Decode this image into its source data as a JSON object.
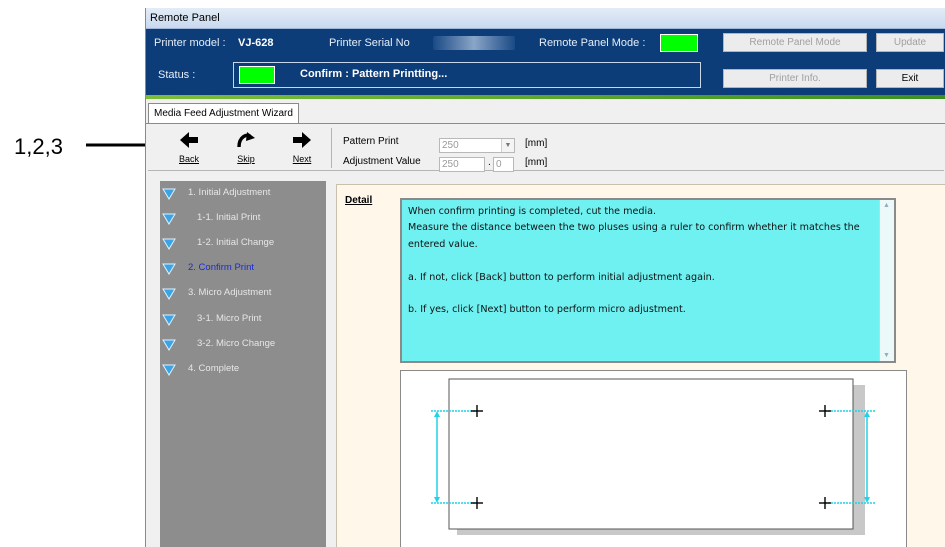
{
  "annotation": {
    "label": "1,2,3"
  },
  "window": {
    "title": "Remote Panel"
  },
  "header": {
    "printer_model_label": "Printer model :",
    "printer_model_value": "VJ-628",
    "serial_label": "Printer Serial No",
    "remote_mode_label": "Remote Panel Mode :",
    "status_label": "Status :",
    "status_text": "Confirm : Pattern Printting...",
    "btn_remote_panel_mode": "Remote Panel Mode",
    "btn_update": "Update",
    "btn_printer_info": "Printer Info.",
    "btn_exit": "Exit",
    "indicator_color": "#00ff00"
  },
  "tab": {
    "label": "Media Feed Adjustment Wizard"
  },
  "toolbar": {
    "back": "Back",
    "skip": "Skip",
    "next": "Next",
    "pattern_print_label": "Pattern Print",
    "pattern_print_value": "250",
    "pattern_print_unit": "[mm]",
    "adjustment_label": "Adjustment Value",
    "adjustment_value_int": "250",
    "adjustment_sep": ".",
    "adjustment_value_dec": "0",
    "adjustment_unit": "[mm]"
  },
  "steps": [
    {
      "label": "1. Initial Adjustment",
      "active": false
    },
    {
      "label": "1-1.  Initial Print",
      "active": false
    },
    {
      "label": "1-2.  Initial Change",
      "active": false
    },
    {
      "label": "2. Confirm Print",
      "active": true
    },
    {
      "label": "3. Micro Adjustment",
      "active": false
    },
    {
      "label": "3-1.  Micro Print",
      "active": false
    },
    {
      "label": "3-2.  Micro Change",
      "active": false
    },
    {
      "label": "4. Complete",
      "active": false
    }
  ],
  "detail": {
    "label": "Detail",
    "line1": "When confirm printing is completed, cut the media.",
    "line2": "Measure the distance between the two pluses using a ruler to confirm whether it matches the entered value.",
    "line3": "a. If not, click [Back] button to perform initial adjustment again.",
    "line4": "b. If yes, click [Next] button to perform micro adjustment."
  },
  "colors": {
    "header_bg": "#0c3d78",
    "accent_line": "#5aa82c",
    "detail_bg": "#6ff1f1",
    "steps_bg": "#8d8d8d",
    "active_step": "#1a2bd6",
    "measure": "#1fd3e8"
  },
  "icons": {
    "back": "arrow-left-icon",
    "skip": "curved-arrow-right-icon",
    "next": "arrow-right-icon",
    "step": "triangle-down-icon"
  }
}
